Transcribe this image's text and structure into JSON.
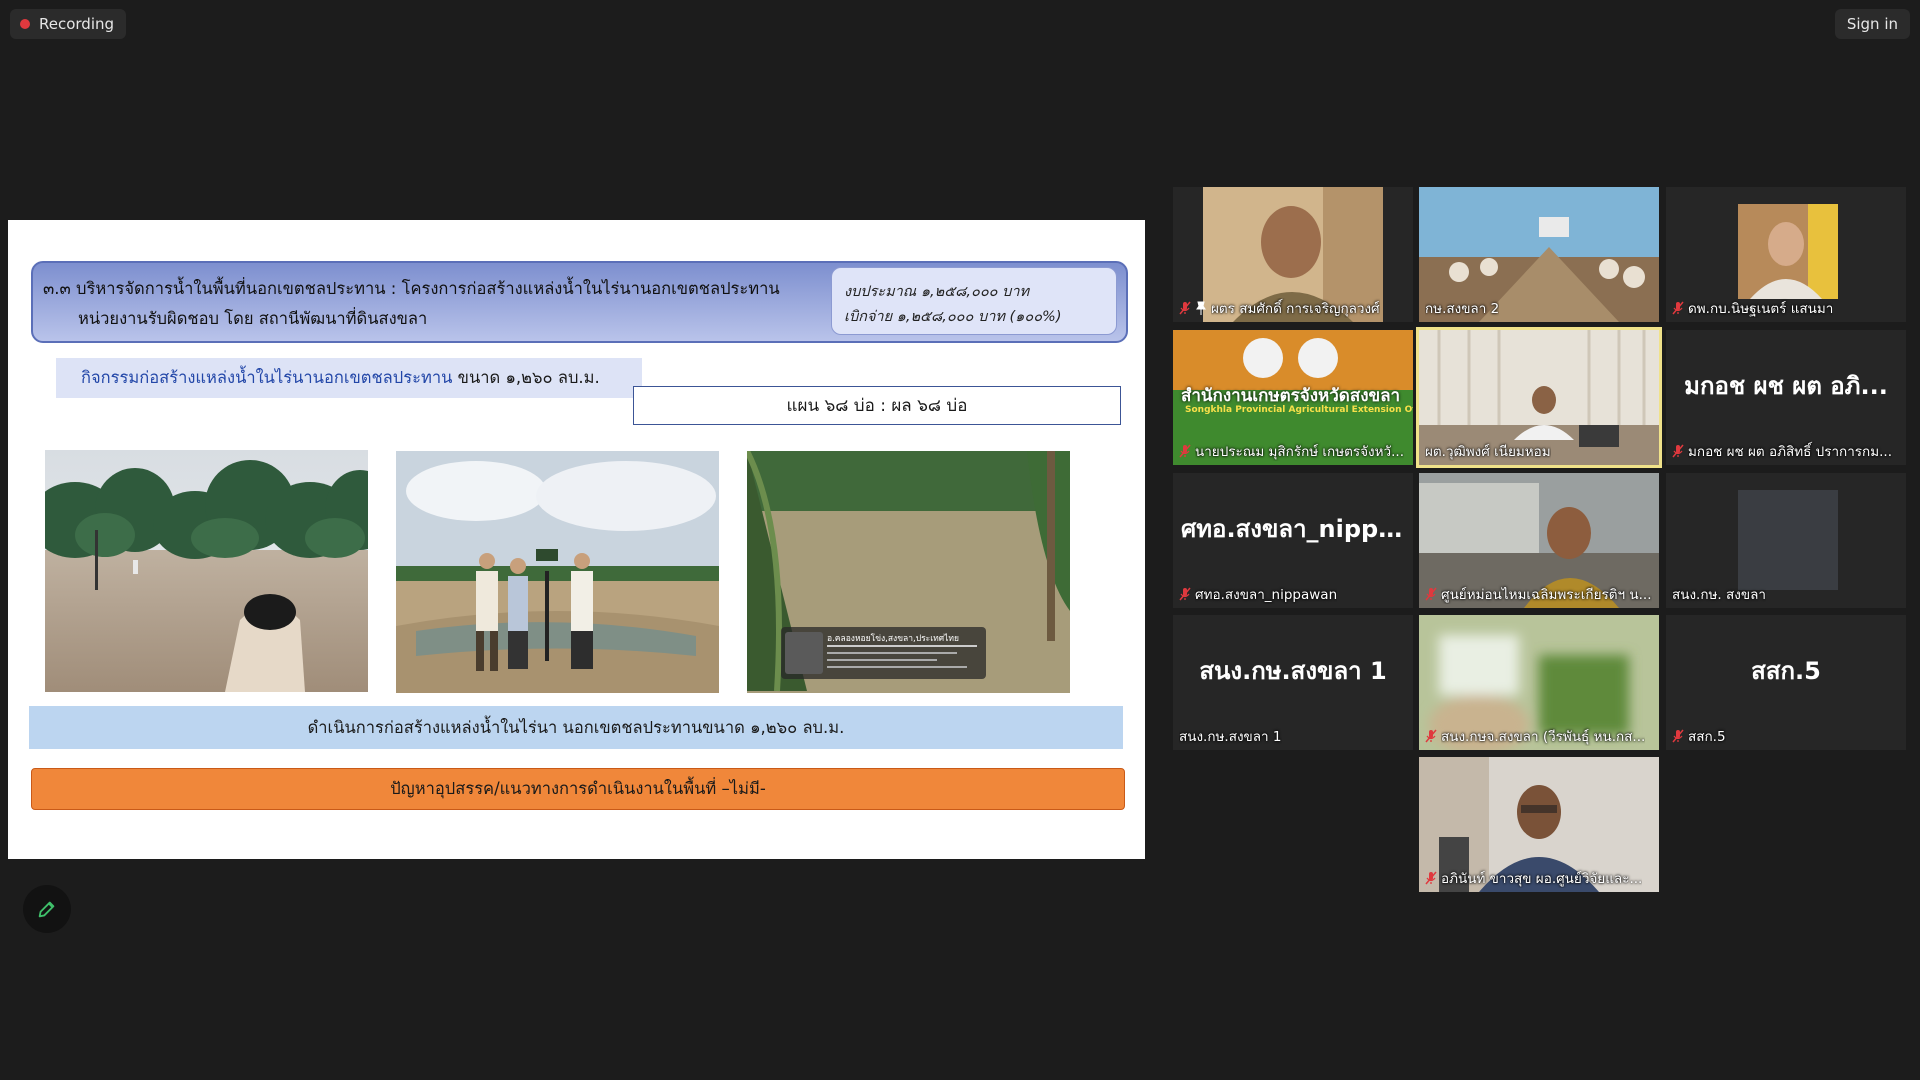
{
  "top_bar": {
    "recording_label": "Recording",
    "sign_in_label": "Sign in",
    "record_color": "#e0393e"
  },
  "slide": {
    "header_line1": "๓.๓ บริหารจัดการน้ำในพื้นที่นอกเขตชลประทาน : โครงการก่อสร้างแหล่งน้ำในไร่นานอกเขตชลประทาน",
    "header_line2": "หน่วยงานรับผิดชอบ โดย สถานีพัฒนาที่ดินสงขลา",
    "budget_line1": "งบประมาณ ๑,๒๕๘,๐๐๐ บาท",
    "budget_line2": "เบิกจ่าย     ๑,๒๕๘,๐๐๐ บาท (๑๐๐%)",
    "activity_label": "กิจกรรมก่อสร้างแหล่งน้ำในไร่นานอกเขตชลประทาน",
    "activity_size": " ขนาด ๑,๒๖๐ ลบ.ม.",
    "plan_label": "แผน ๖๘ บ่อ : ผล ๖๘ บ่อ",
    "photo3_overlay_title": "อ.คลองหอยโข่ง,สงขลา,ประเทศไทย",
    "result_text": "ดำเนินการก่อสร้างแหล่งน้ำในไร่นา นอกเขตชลประทานขนาด ๑,๒๖๐ ลบ.ม.",
    "problem_text": "ปัญหาอุปสรรค/แนวทางการดำเนินงานในพื้นที่ –ไม่มี-"
  },
  "annotate_button": {
    "icon": "pencil-icon",
    "color": "#3fbf6a"
  },
  "participants": [
    {
      "name": "ผตร สมศักดิ์ การเจริญกุลวงศ์",
      "muted": true,
      "pinned": true,
      "video": "man-uniform"
    },
    {
      "name": "กษ.สงขลา 2",
      "muted": false,
      "video": "meeting-room"
    },
    {
      "name": "ดพ.กบ.นิษฐเนตร์ แสนมา",
      "muted": true,
      "video": "woman-uniform"
    },
    {
      "name": "นายประณม มุสิกรักษ์ เกษตรจังหวั...",
      "muted": true,
      "video": "agri-banner",
      "banner_text": "สำนักงานเกษตรจังหวัดสงขลา",
      "banner_sub": "Songkhla Provincial Agricultural Extension Office"
    },
    {
      "name": "ผต.วุฒิพงศ์ เนียมหอม",
      "muted": false,
      "active": true,
      "video": "man-desk"
    },
    {
      "name": "มกอช ผช ผต อภิสิทธิ์ ปราการกม...",
      "muted": true,
      "display": "มกอช ผช ผต อภิ..."
    },
    {
      "name": "ศทอ.สงขลา_nippawan",
      "muted": true,
      "display": "ศทอ.สงขลา_nipp..."
    },
    {
      "name": "ศูนย์หม่อนไหมเฉลิมพระเกียรติฯ น...",
      "muted": true,
      "video": "man-office"
    },
    {
      "name": "สนง.กษ. สงขลา",
      "muted": false,
      "video": "dark-square"
    },
    {
      "name": "สนง.กษ.สงขลา 1",
      "muted": false,
      "display": "สนง.กษ.สงขลา 1"
    },
    {
      "name": "สนง.กษจ.สงขลา (วีรพันธุ์ หน.กส...",
      "muted": true,
      "video": "blurred"
    },
    {
      "name": "สสก.5",
      "muted": true,
      "display": "สสก.5"
    },
    {
      "name": "อภินันท์ ขาวสุข ผอ.ศูนย์วิจัยและ...",
      "muted": true,
      "video": "man-glasses"
    }
  ]
}
